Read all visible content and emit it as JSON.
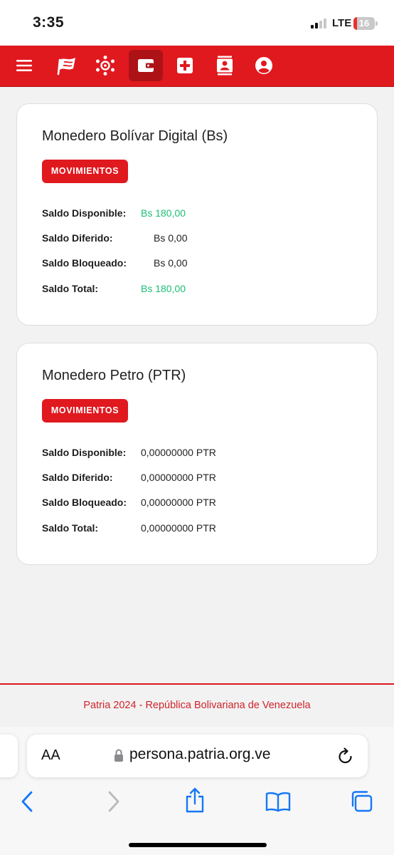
{
  "status_bar": {
    "time": "3:35",
    "network": "LTE",
    "battery_level": "16",
    "signal_bars": 2
  },
  "navbar": {
    "items": [
      {
        "icon": "hamburger-menu-icon",
        "active": false
      },
      {
        "icon": "flag-logo-icon",
        "active": false
      },
      {
        "icon": "network-hub-icon",
        "active": false
      },
      {
        "icon": "wallet-icon",
        "active": true
      },
      {
        "icon": "health-cross-icon",
        "active": false
      },
      {
        "icon": "contact-card-icon",
        "active": false
      },
      {
        "icon": "user-profile-icon",
        "active": false
      }
    ],
    "colors": {
      "bar": "#e0191f",
      "active": "#ad1217"
    }
  },
  "wallets": [
    {
      "title": "Monedero Bolívar Digital (Bs)",
      "button_label": "MOVIMIENTOS",
      "rows": [
        {
          "label": "Saldo Disponible:",
          "value": "Bs 180,00"
        },
        {
          "label": "Saldo Diferido:",
          "value": "Bs 0,00"
        },
        {
          "label": "Saldo Bloqueado:",
          "value": "Bs 0,00"
        },
        {
          "label": "Saldo Total:",
          "value": "Bs 180,00"
        }
      ]
    },
    {
      "title": "Monedero Petro (PTR)",
      "button_label": "MOVIMIENTOS",
      "rows": [
        {
          "label": "Saldo Disponible:",
          "value": "0,00000000 PTR"
        },
        {
          "label": "Saldo Diferido:",
          "value": "0,00000000 PTR"
        },
        {
          "label": "Saldo Bloqueado:",
          "value": "0,00000000 PTR"
        },
        {
          "label": "Saldo Total:",
          "value": "0,00000000 PTR"
        }
      ]
    }
  ],
  "colors": {
    "positive_balance": "#1bbf73",
    "brand_red": "#e0191f"
  },
  "footer": {
    "text": "Patria 2024 - República Bolivariana de Venezuela"
  },
  "browser": {
    "text_size_button": "AA",
    "url": "persona.patria.org.ve",
    "toolbar": [
      "back-icon",
      "forward-icon",
      "share-icon",
      "bookmarks-icon",
      "tabs-icon"
    ]
  }
}
